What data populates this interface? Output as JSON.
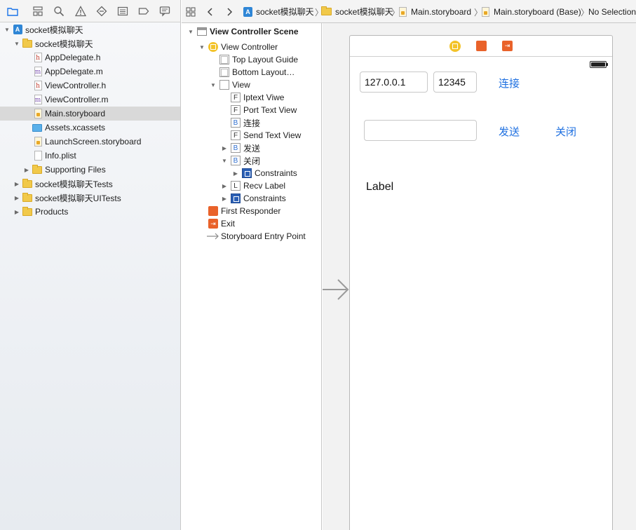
{
  "navigator": {
    "tabs": [
      "folder-icon",
      "hierarchy-icon",
      "search-icon",
      "warning-icon",
      "test-icon",
      "list-icon",
      "breakpoint-icon",
      "comment-icon"
    ],
    "items": [
      {
        "label": "socket模拟聊天",
        "icon": "project-icon",
        "disclosure": "open",
        "depth": 0
      },
      {
        "label": "socket模拟聊天",
        "icon": "folder-icon",
        "disclosure": "open",
        "depth": 1
      },
      {
        "label": "AppDelegate.h",
        "icon": "header-file-icon",
        "depth": 2
      },
      {
        "label": "AppDelegate.m",
        "icon": "source-file-icon",
        "depth": 2
      },
      {
        "label": "ViewController.h",
        "icon": "header-file-icon",
        "depth": 2
      },
      {
        "label": "ViewController.m",
        "icon": "source-file-icon",
        "depth": 2
      },
      {
        "label": "Main.storyboard",
        "icon": "storyboard-icon",
        "depth": 2,
        "selected": true
      },
      {
        "label": "Assets.xcassets",
        "icon": "assets-folder-icon",
        "depth": 2
      },
      {
        "label": "LaunchScreen.storyboard",
        "icon": "storyboard-icon",
        "depth": 2
      },
      {
        "label": "Info.plist",
        "icon": "plist-icon",
        "depth": 2
      },
      {
        "label": "Supporting Files",
        "icon": "folder-icon",
        "disclosure": "closed",
        "depth": 2
      },
      {
        "label": "socket模拟聊天Tests",
        "icon": "folder-icon",
        "disclosure": "closed",
        "depth": 1
      },
      {
        "label": "socket模拟聊天UITests",
        "icon": "folder-icon",
        "disclosure": "closed",
        "depth": 1
      },
      {
        "label": "Products",
        "icon": "folder-icon",
        "disclosure": "closed",
        "depth": 1
      }
    ]
  },
  "jumpbar": {
    "crumbs": [
      "socket模拟聊天",
      "socket模拟聊天",
      "Main.storyboard",
      "Main.storyboard (Base)",
      "No Selection"
    ]
  },
  "outline": {
    "items": [
      {
        "label": "View Controller Scene",
        "icon": "scene-icon",
        "disclosure": "open",
        "bold": true
      },
      {
        "label": "View Controller",
        "icon": "view-controller-icon",
        "disclosure": "open"
      },
      {
        "label": "Top Layout Guide",
        "icon": "layout-guide-icon"
      },
      {
        "label": "Bottom Layout…",
        "icon": "layout-guide-icon"
      },
      {
        "label": "View",
        "icon": "view-icon",
        "disclosure": "open"
      },
      {
        "label": "Iptext Viwe",
        "icon": "textfield-icon",
        "glyph": "F"
      },
      {
        "label": "Port Text View",
        "icon": "textfield-icon",
        "glyph": "F"
      },
      {
        "label": "连接",
        "icon": "button-icon",
        "glyph": "B"
      },
      {
        "label": "Send Text View",
        "icon": "textfield-icon",
        "glyph": "F"
      },
      {
        "label": "发送",
        "icon": "button-icon",
        "glyph": "B",
        "disclosure": "closed"
      },
      {
        "label": "关闭",
        "icon": "button-icon",
        "glyph": "B",
        "disclosure": "open"
      },
      {
        "label": "Constraints",
        "icon": "constraints-icon",
        "disclosure": "closed"
      },
      {
        "label": "Recv Label",
        "icon": "label-icon",
        "glyph": "L",
        "disclosure": "closed"
      },
      {
        "label": "Constraints",
        "icon": "constraints-icon",
        "disclosure": "closed"
      },
      {
        "label": "First Responder",
        "icon": "first-responder-icon"
      },
      {
        "label": "Exit",
        "icon": "exit-icon"
      },
      {
        "label": "Storyboard Entry Point",
        "icon": "entry-arrow-icon"
      }
    ]
  },
  "canvas": {
    "ip_value": "127.0.0.1",
    "port_value": "12345",
    "send_value": "",
    "connect_label": "连接",
    "send_label": "发送",
    "close_label": "关闭",
    "recv_label": "Label",
    "accent_color": "#1d6fe0"
  }
}
